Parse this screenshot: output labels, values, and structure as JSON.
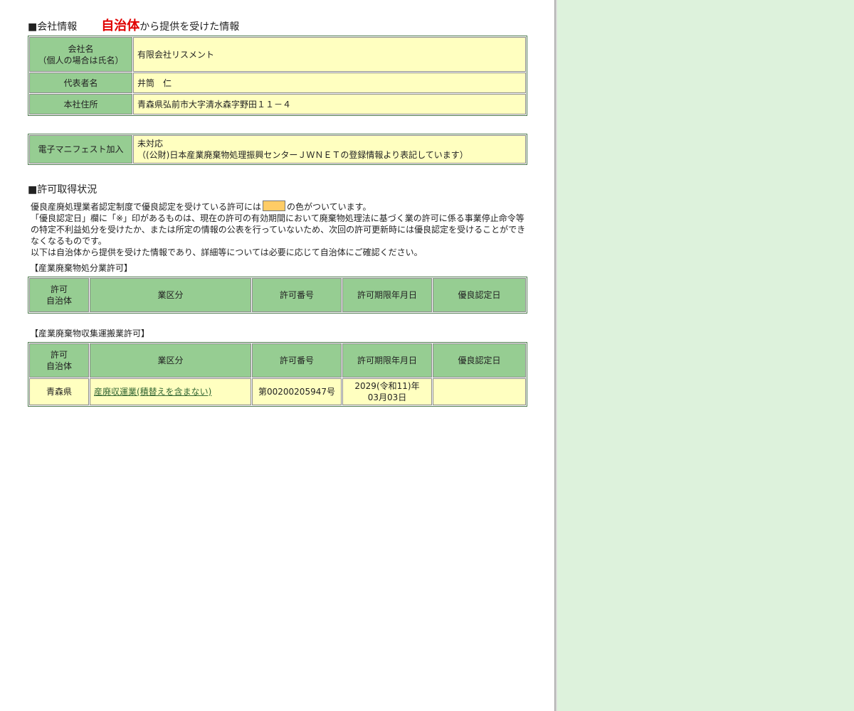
{
  "company_section": {
    "heading_mark": "■会社情報",
    "heading_highlight": "自治体",
    "heading_suffix": "から提供を受けた情報",
    "rows": [
      {
        "label_line1": "会社名",
        "label_line2": "（個人の場合は氏名）",
        "value": "有限会社リスメント"
      },
      {
        "label": "代表者名",
        "value": "井筒　仁"
      },
      {
        "label": "本社住所",
        "value": "青森県弘前市大字清水森字野田１１－４"
      }
    ]
  },
  "manifest": {
    "label": "電子マニフェスト加入",
    "value_line1": "未対応",
    "value_line2": "（(公財)日本産業廃棄物処理振興センターＪＷＮＥＴの登録情報より表記しています）"
  },
  "permit_section": {
    "heading": "■許可取得状況",
    "note_pre": "優良産廃処理業者認定制度で優良認定を受けている許可には",
    "note_post": "の色がついています。",
    "note2": "「優良認定日」欄に「※」印があるものは、現在の許可の有効期間において廃棄物処理法に基づく業の許可に係る事業停止命令等の特定不利益処分を受けたか、または所定の情報の公表を行っていないため、次回の許可更新時には優良認定を受けることができなくなるものです。",
    "note3": "以下は自治体から提供を受けた情報であり、詳細等については必要に応じて自治体にご確認ください。",
    "swatch_color": "#ffcc66"
  },
  "table_headers": {
    "permit_line1": "許可",
    "permit_line2": "自治体",
    "category": "業区分",
    "number": "許可番号",
    "expiry": "許可期限年月日",
    "excellent": "優良認定日"
  },
  "disposal": {
    "caption": "【産業廃棄物処分業許可】",
    "rows": []
  },
  "collection": {
    "caption": "【産業廃棄物収集運搬業許可】",
    "rows": [
      {
        "authority": "青森県",
        "category": "産廃収運業(積替えを含まない)",
        "number": "第00200205947号",
        "expiry_line1": "2029(令和11)年",
        "expiry_line2": "03月03日",
        "excellent": ""
      }
    ]
  },
  "colors": {
    "header_green": "#96cd92",
    "value_yellow": "#ffffc0",
    "side_panel": "#ddf2dc",
    "highlight_red": "#e00000"
  }
}
